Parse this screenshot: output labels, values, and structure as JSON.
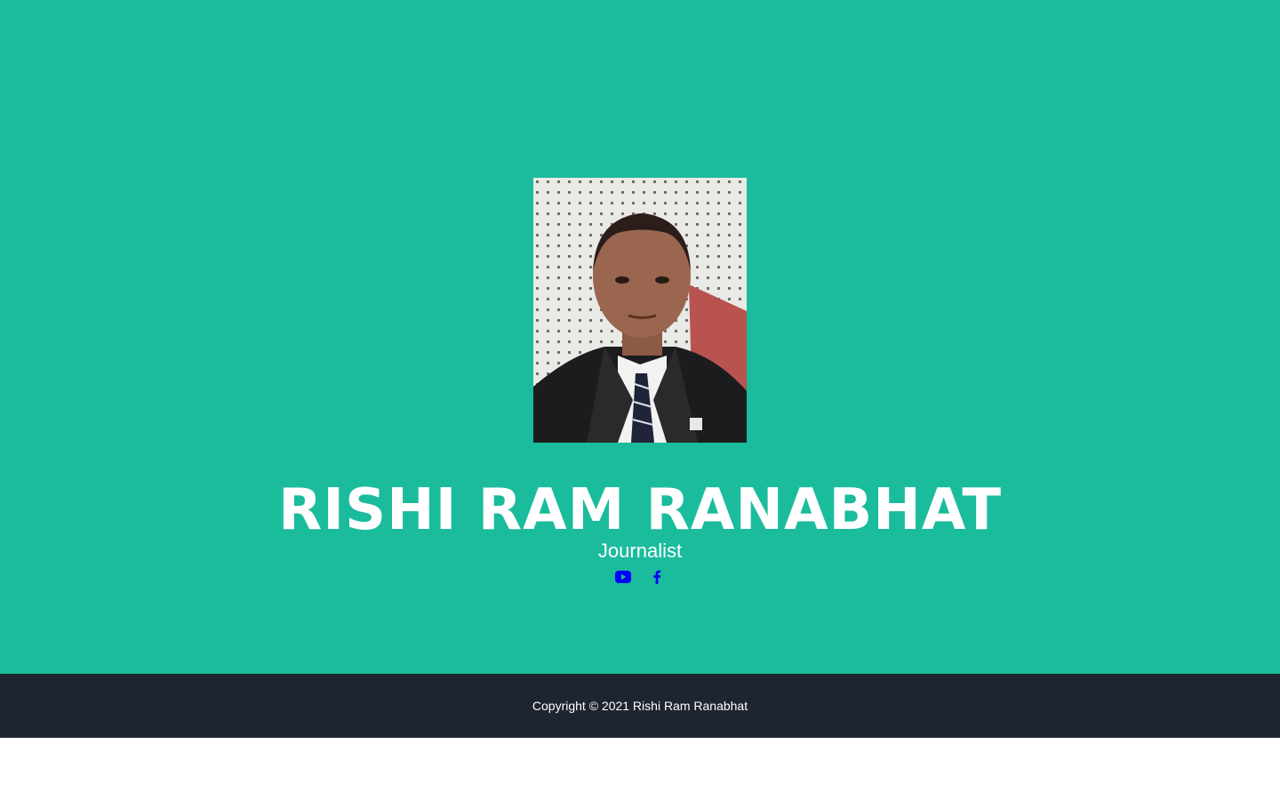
{
  "profile": {
    "name": "RISHI RAM RANABHAT",
    "role": "Journalist",
    "photo_icon": "portrait-photo"
  },
  "socials": [
    {
      "icon": "youtube-icon",
      "color": "#0000ff"
    },
    {
      "icon": "facebook-icon",
      "color": "#0000ff"
    }
  ],
  "footer": {
    "copyright": "Copyright © 2021 Rishi Ram Ranabhat"
  },
  "colors": {
    "hero_bg": "#1abc9c",
    "footer_bg": "#1e2530",
    "text": "#ffffff",
    "icon": "#0000ff"
  }
}
